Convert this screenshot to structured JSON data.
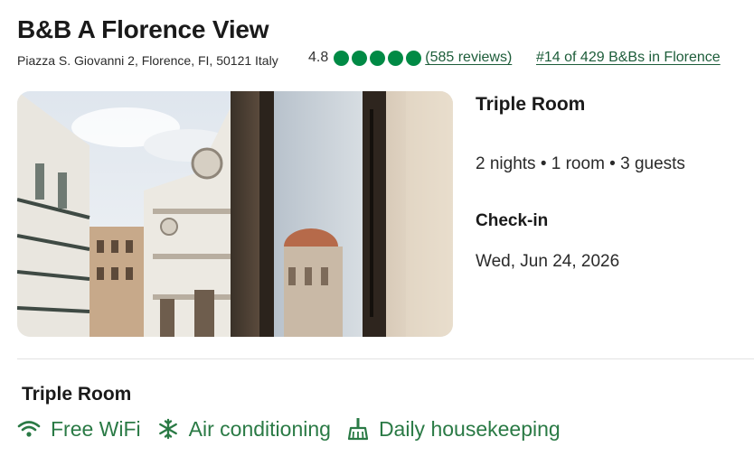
{
  "hotel": {
    "name": "B&B A Florence View",
    "address": "Piazza S. Giovanni 2, Florence, FI, 50121 Italy",
    "rating": "4.8",
    "bubbles_filled": 5,
    "bubbles_total": 5,
    "reviews_text": "(585 reviews)",
    "rank_text": "#14 of 429 B&Bs in Florence"
  },
  "booking": {
    "room_type": "Triple Room",
    "stay_summary": "2 nights • 1 room • 3 guests",
    "checkin_label": "Check-in",
    "checkin_date": "Wed, Jun 24, 2026"
  },
  "room_section": {
    "title": "Triple Room",
    "amenities": [
      {
        "label": "Free WiFi",
        "icon": "wifi-icon"
      },
      {
        "label": "Air conditioning",
        "icon": "snowflake-icon"
      },
      {
        "label": "Daily housekeeping",
        "icon": "broom-icon"
      }
    ]
  },
  "colors": {
    "accent_green": "#2a7a45",
    "bubble_green": "#008a45",
    "link_green": "#1d5d3a"
  }
}
